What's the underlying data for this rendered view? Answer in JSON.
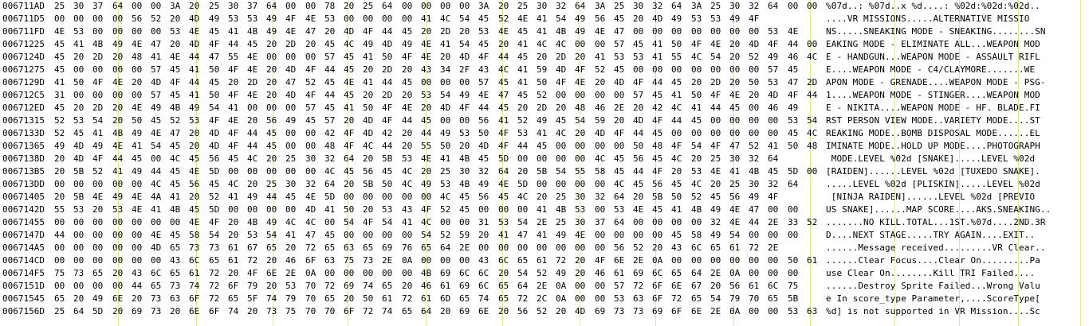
{
  "hex_view": {
    "separator_color": "#e7e38a",
    "rows": [
      {
        "address": "006711AD",
        "bytes": [
          "25",
          "30",
          "37",
          "64",
          "00",
          "00",
          "3A",
          "20",
          "25",
          "30",
          "37",
          "64",
          "00",
          "00",
          "78",
          "20",
          "25",
          "64",
          "00",
          "00",
          "00",
          "00",
          "3A",
          "20",
          "25",
          "30",
          "32",
          "64",
          "3A",
          "25",
          "30",
          "32",
          "64",
          "3A",
          "25",
          "30",
          "32",
          "64",
          "00",
          "00"
        ],
        "ascii": "%07d..: %07d..x %d....: %02d:%02d:%02d.."
      },
      {
        "address": "006711D5",
        "bytes": [
          "00",
          "00",
          "00",
          "00",
          "56",
          "52",
          "20",
          "4D",
          "49",
          "53",
          "53",
          "49",
          "4F",
          "4E",
          "53",
          "00",
          "00",
          "00",
          "00",
          "41",
          "4C",
          "54",
          "45",
          "52",
          "4E",
          "41",
          "54",
          "49",
          "56",
          "45",
          "20",
          "4D",
          "49",
          "53",
          "53",
          "49",
          "4F",
          "",
          "",
          ""
        ],
        "ascii": "....VR MISSIONS.....ALTERNATIVE MISSIO"
      },
      {
        "address": "006711FD",
        "bytes": [
          "4E",
          "53",
          "00",
          "00",
          "00",
          "00",
          "53",
          "4E",
          "45",
          "41",
          "4B",
          "49",
          "4E",
          "47",
          "20",
          "4D",
          "4F",
          "44",
          "45",
          "20",
          "2D",
          "20",
          "53",
          "4E",
          "45",
          "41",
          "4B",
          "49",
          "4E",
          "47",
          "00",
          "00",
          "00",
          "00",
          "00",
          "00",
          "00",
          "53",
          "4E",
          ""
        ],
        "ascii": "NS.....SNEAKING MODE - SNEAKING........SN"
      },
      {
        "address": "00671225",
        "bytes": [
          "45",
          "41",
          "4B",
          "49",
          "4E",
          "47",
          "20",
          "4D",
          "4F",
          "44",
          "45",
          "20",
          "2D",
          "20",
          "45",
          "4C",
          "49",
          "4D",
          "49",
          "4E",
          "41",
          "54",
          "45",
          "20",
          "41",
          "4C",
          "4C",
          "00",
          "00",
          "57",
          "45",
          "41",
          "50",
          "4F",
          "4E",
          "20",
          "4D",
          "4F",
          "44",
          "00"
        ],
        "ascii": "EAKING MODE - ELIMINATE ALL...WEAPON MOD"
      },
      {
        "address": "0067124D",
        "bytes": [
          "45",
          "20",
          "2D",
          "20",
          "48",
          "41",
          "4E",
          "44",
          "47",
          "55",
          "4E",
          "00",
          "00",
          "00",
          "57",
          "45",
          "41",
          "50",
          "4F",
          "4E",
          "20",
          "4D",
          "4F",
          "44",
          "45",
          "20",
          "2D",
          "20",
          "41",
          "53",
          "53",
          "41",
          "55",
          "4C",
          "54",
          "20",
          "52",
          "49",
          "46",
          "4C"
        ],
        "ascii": "E - HANDGUN...WEAPON MODE - ASSAULT RIFL"
      },
      {
        "address": "00671275",
        "bytes": [
          "45",
          "00",
          "00",
          "00",
          "00",
          "57",
          "45",
          "41",
          "50",
          "4F",
          "4E",
          "20",
          "4D",
          "4F",
          "44",
          "45",
          "20",
          "2D",
          "20",
          "43",
          "34",
          "2F",
          "43",
          "4C",
          "41",
          "59",
          "4D",
          "4F",
          "52",
          "45",
          "00",
          "00",
          "00",
          "00",
          "00",
          "00",
          "00",
          "57",
          "45",
          ""
        ],
        "ascii": "E....WEAPON MODE - C4/CLAYMORE.......WE"
      },
      {
        "address": "0067129D",
        "bytes": [
          "41",
          "50",
          "4F",
          "4E",
          "20",
          "4D",
          "4F",
          "44",
          "45",
          "20",
          "2D",
          "20",
          "47",
          "52",
          "45",
          "4E",
          "41",
          "44",
          "45",
          "00",
          "00",
          "00",
          "57",
          "45",
          "41",
          "50",
          "4F",
          "4E",
          "20",
          "4D",
          "4F",
          "44",
          "45",
          "20",
          "2D",
          "20",
          "50",
          "53",
          "47",
          "2D"
        ],
        "ascii": "APON MODE - GRENADE....WEAPON MODE - PSG-"
      },
      {
        "address": "006712C5",
        "bytes": [
          "31",
          "00",
          "00",
          "00",
          "00",
          "57",
          "45",
          "41",
          "50",
          "4F",
          "4E",
          "20",
          "4D",
          "4F",
          "44",
          "45",
          "20",
          "2D",
          "20",
          "53",
          "54",
          "49",
          "4E",
          "47",
          "45",
          "52",
          "00",
          "00",
          "00",
          "00",
          "57",
          "45",
          "41",
          "50",
          "4F",
          "4E",
          "20",
          "4D",
          "4F",
          "44"
        ],
        "ascii": "1....WEAPON MODE - STINGER....WEAPON MOD"
      },
      {
        "address": "006712ED",
        "bytes": [
          "45",
          "20",
          "2D",
          "20",
          "4E",
          "49",
          "4B",
          "49",
          "54",
          "41",
          "00",
          "00",
          "00",
          "57",
          "45",
          "41",
          "50",
          "4F",
          "4E",
          "20",
          "4D",
          "4F",
          "44",
          "45",
          "20",
          "2D",
          "20",
          "48",
          "46",
          "2E",
          "20",
          "42",
          "4C",
          "41",
          "44",
          "45",
          "00",
          "46",
          "49",
          ""
        ],
        "ascii": "E - NIKITA....WEAPON MODE - HF. BLADE.FI"
      },
      {
        "address": "00671315",
        "bytes": [
          "52",
          "53",
          "54",
          "20",
          "50",
          "45",
          "52",
          "53",
          "4F",
          "4E",
          "20",
          "56",
          "49",
          "45",
          "57",
          "20",
          "4D",
          "4F",
          "44",
          "45",
          "00",
          "00",
          "56",
          "41",
          "52",
          "49",
          "45",
          "54",
          "59",
          "20",
          "4D",
          "4F",
          "44",
          "45",
          "00",
          "00",
          "00",
          "00",
          "53",
          "54"
        ],
        "ascii": "RST PERSON VIEW MODE..VARIETY MODE....ST"
      },
      {
        "address": "0067133D",
        "bytes": [
          "52",
          "45",
          "41",
          "4B",
          "49",
          "4E",
          "47",
          "20",
          "4D",
          "4F",
          "44",
          "45",
          "00",
          "00",
          "42",
          "4F",
          "4D",
          "42",
          "20",
          "44",
          "49",
          "53",
          "50",
          "4F",
          "53",
          "41",
          "4C",
          "20",
          "4D",
          "4F",
          "44",
          "45",
          "00",
          "00",
          "00",
          "00",
          "00",
          "00",
          "45",
          "4C"
        ],
        "ascii": "REAKING MODE..BOMB DISPOSAL MODE......EL"
      },
      {
        "address": "00671365",
        "bytes": [
          "49",
          "4D",
          "49",
          "4E",
          "41",
          "54",
          "45",
          "20",
          "4D",
          "4F",
          "44",
          "45",
          "00",
          "00",
          "48",
          "4F",
          "4C",
          "44",
          "20",
          "55",
          "50",
          "20",
          "4D",
          "4F",
          "44",
          "45",
          "00",
          "00",
          "00",
          "00",
          "50",
          "48",
          "4F",
          "54",
          "4F",
          "47",
          "52",
          "41",
          "50",
          "48"
        ],
        "ascii": "IMINATE MODE..HOLD UP MODE....PHOTOGRAPH"
      },
      {
        "address": "0067138D",
        "bytes": [
          "20",
          "4D",
          "4F",
          "44",
          "45",
          "00",
          "4C",
          "45",
          "56",
          "45",
          "4C",
          "20",
          "25",
          "30",
          "32",
          "64",
          "20",
          "5B",
          "53",
          "4E",
          "41",
          "4B",
          "45",
          "5D",
          "00",
          "00",
          "00",
          "00",
          "4C",
          "45",
          "56",
          "45",
          "4C",
          "20",
          "25",
          "30",
          "32",
          "64",
          "",
          "",
          ""
        ],
        "ascii": " MODE.LEVEL %02d [SNAKE].....LEVEL %02d"
      },
      {
        "address": "006713B5",
        "bytes": [
          "20",
          "5B",
          "52",
          "41",
          "49",
          "44",
          "45",
          "4E",
          "5D",
          "00",
          "00",
          "00",
          "00",
          "00",
          "4C",
          "45",
          "56",
          "45",
          "4C",
          "20",
          "25",
          "30",
          "32",
          "64",
          "20",
          "5B",
          "54",
          "55",
          "58",
          "45",
          "44",
          "4F",
          "20",
          "53",
          "4E",
          "41",
          "4B",
          "45",
          "5D",
          "00"
        ],
        "ascii": "[RAIDEN]......LEVEL %02d [TUXEDO SNAKE]."
      },
      {
        "address": "006713DD",
        "bytes": [
          "00",
          "00",
          "00",
          "00",
          "00",
          "4C",
          "45",
          "56",
          "45",
          "4C",
          "20",
          "25",
          "30",
          "32",
          "64",
          "20",
          "5B",
          "50",
          "4C",
          "49",
          "53",
          "4B",
          "49",
          "4E",
          "5D",
          "00",
          "00",
          "00",
          "00",
          "4C",
          "45",
          "56",
          "45",
          "4C",
          "20",
          "25",
          "30",
          "32",
          "64",
          ""
        ],
        "ascii": ".....LEVEL %02d [PLISKIN].....LEVEL %02d"
      },
      {
        "address": "00671405",
        "bytes": [
          "20",
          "5B",
          "4E",
          "49",
          "4E",
          "4A",
          "41",
          "20",
          "52",
          "41",
          "49",
          "44",
          "45",
          "4E",
          "5D",
          "00",
          "00",
          "00",
          "00",
          "00",
          "4C",
          "45",
          "56",
          "45",
          "4C",
          "20",
          "25",
          "30",
          "32",
          "64",
          "20",
          "5B",
          "50",
          "52",
          "45",
          "56",
          "49",
          "4F",
          "",
          ""
        ],
        "ascii": " [NINJA RAIDEN]......LEVEL %02d [PREVIO"
      },
      {
        "address": "0067142D",
        "bytes": [
          "55",
          "53",
          "20",
          "53",
          "4E",
          "41",
          "4B",
          "45",
          "5D",
          "00",
          "00",
          "00",
          "00",
          "4D",
          "41",
          "50",
          "20",
          "53",
          "43",
          "4F",
          "52",
          "45",
          "00",
          "00",
          "00",
          "41",
          "4B",
          "53",
          "00",
          "53",
          "4E",
          "45",
          "41",
          "4B",
          "49",
          "4E",
          "47",
          "00",
          "00",
          ""
        ],
        "ascii": "US SNAKE]......MAP SCORE....AKS.SNEAKING.."
      },
      {
        "address": "00671455",
        "bytes": [
          "00",
          "00",
          "00",
          "00",
          "00",
          "00",
          "00",
          "4E",
          "4F",
          "20",
          "4B",
          "49",
          "4C",
          "4C",
          "00",
          "54",
          "4F",
          "54",
          "41",
          "4C",
          "00",
          "00",
          "31",
          "53",
          "54",
          "2E",
          "25",
          "30",
          "37",
          "64",
          "00",
          "00",
          "00",
          "00",
          "32",
          "4E",
          "44",
          "2E",
          "33",
          "52"
        ],
        "ascii": ".......NO KILL.TOTAL...1ST.%07d....2ND.3R"
      },
      {
        "address": "0067147D",
        "bytes": [
          "44",
          "00",
          "00",
          "00",
          "00",
          "4E",
          "45",
          "58",
          "54",
          "20",
          "53",
          "54",
          "41",
          "47",
          "45",
          "00",
          "00",
          "00",
          "00",
          "54",
          "52",
          "59",
          "20",
          "41",
          "47",
          "41",
          "49",
          "4E",
          "00",
          "00",
          "00",
          "00",
          "45",
          "58",
          "49",
          "54",
          "00",
          "00",
          "00",
          ""
        ],
        "ascii": "D....NEXT STAGE.....TRY AGAIN....EXIT.."
      },
      {
        "address": "006714A5",
        "bytes": [
          "00",
          "00",
          "00",
          "00",
          "00",
          "4D",
          "65",
          "73",
          "73",
          "61",
          "67",
          "65",
          "20",
          "72",
          "65",
          "63",
          "65",
          "69",
          "76",
          "65",
          "64",
          "2E",
          "00",
          "00",
          "00",
          "00",
          "00",
          "00",
          "00",
          "56",
          "52",
          "20",
          "43",
          "6C",
          "65",
          "61",
          "72",
          "2E",
          "",
          ""
        ],
        "ascii": "......Message received.........VR Clear.."
      },
      {
        "address": "006714CD",
        "bytes": [
          "00",
          "00",
          "00",
          "00",
          "00",
          "00",
          "43",
          "6C",
          "65",
          "61",
          "72",
          "20",
          "46",
          "6F",
          "63",
          "75",
          "73",
          "2E",
          "0A",
          "00",
          "00",
          "00",
          "43",
          "6C",
          "65",
          "61",
          "72",
          "20",
          "4F",
          "6E",
          "2E",
          "0A",
          "00",
          "00",
          "00",
          "00",
          "00",
          "00",
          "50",
          "61"
        ],
        "ascii": "......Clear Focus....Clear On.........Pa"
      },
      {
        "address": "006714F5",
        "bytes": [
          "75",
          "73",
          "65",
          "20",
          "43",
          "6C",
          "65",
          "61",
          "72",
          "20",
          "4F",
          "6E",
          "2E",
          "0A",
          "00",
          "00",
          "00",
          "00",
          "00",
          "4B",
          "69",
          "6C",
          "6C",
          "20",
          "54",
          "52",
          "49",
          "20",
          "46",
          "61",
          "69",
          "6C",
          "65",
          "64",
          "2E",
          "0A",
          "00",
          "00",
          "00",
          ""
        ],
        "ascii": "use Clear On........Kill TRI Failed...."
      },
      {
        "address": "0067151D",
        "bytes": [
          "00",
          "00",
          "00",
          "00",
          "44",
          "65",
          "73",
          "74",
          "72",
          "6F",
          "79",
          "20",
          "53",
          "70",
          "72",
          "69",
          "74",
          "65",
          "20",
          "46",
          "61",
          "69",
          "6C",
          "65",
          "64",
          "2E",
          "0A",
          "00",
          "00",
          "57",
          "72",
          "6F",
          "6E",
          "67",
          "20",
          "56",
          "61",
          "6C",
          "75",
          ""
        ],
        "ascii": "......Destroy Sprite Failed...Wrong Valu"
      },
      {
        "address": "00671545",
        "bytes": [
          "65",
          "20",
          "49",
          "6E",
          "20",
          "73",
          "63",
          "6F",
          "72",
          "65",
          "5F",
          "74",
          "79",
          "70",
          "65",
          "20",
          "50",
          "61",
          "72",
          "61",
          "6D",
          "65",
          "74",
          "65",
          "72",
          "2C",
          "0A",
          "00",
          "00",
          "53",
          "63",
          "6F",
          "72",
          "65",
          "54",
          "79",
          "70",
          "65",
          "5B",
          ""
        ],
        "ascii": "e In score_type Parameter,....ScoreType["
      },
      {
        "address": "0067156D",
        "bytes": [
          "25",
          "64",
          "5D",
          "20",
          "69",
          "73",
          "20",
          "6E",
          "6F",
          "74",
          "20",
          "73",
          "75",
          "70",
          "70",
          "6F",
          "72",
          "74",
          "65",
          "64",
          "20",
          "69",
          "6E",
          "20",
          "56",
          "52",
          "20",
          "4D",
          "69",
          "73",
          "73",
          "69",
          "6F",
          "6E",
          "2E",
          "0A",
          "00",
          "00",
          "53",
          "63"
        ],
        "ascii": "%d] is not supported in VR Mission....Sc"
      }
    ]
  }
}
